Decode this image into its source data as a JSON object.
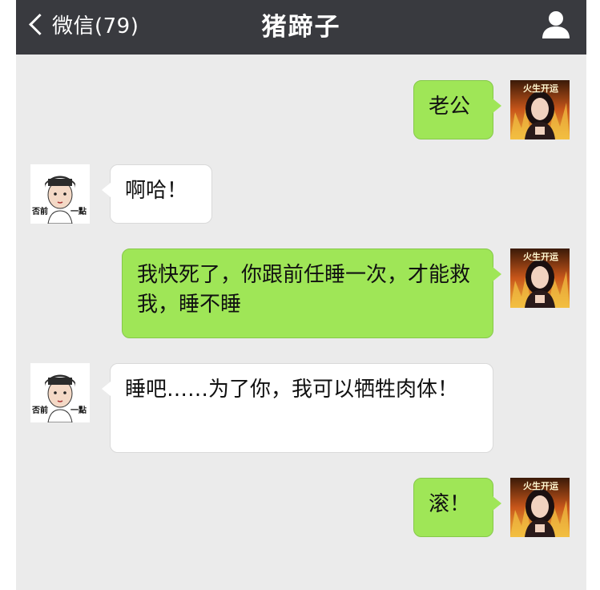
{
  "header": {
    "back_label": "微信(79)",
    "title": "猪蹄子"
  },
  "avatars": {
    "self_banner": "火生开运",
    "contact_left_text": "否前",
    "contact_right_text": "一點"
  },
  "messages": [
    {
      "side": "out",
      "text": "老公"
    },
    {
      "side": "in",
      "text": "啊哈！"
    },
    {
      "side": "out",
      "text": "我快死了，你跟前任睡一次，才能救我，睡不睡"
    },
    {
      "side": "in",
      "text": "睡吧……为了你，我可以牺牲肉体！"
    },
    {
      "side": "out",
      "text": "滚！"
    }
  ],
  "colors": {
    "navbar": "#393a3f",
    "chat_bg": "#ebebeb",
    "outgoing_bubble": "#9fe657",
    "incoming_bubble": "#ffffff"
  },
  "icons": {
    "back": "chevron-left-icon",
    "profile": "person-icon"
  }
}
